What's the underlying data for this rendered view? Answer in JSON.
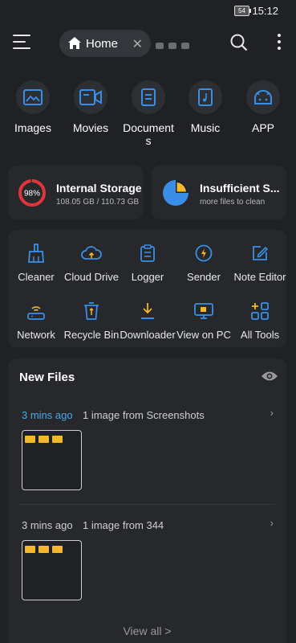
{
  "status": {
    "battery": "54",
    "time": "15:12"
  },
  "appbar": {
    "home_label": "Home",
    "close": "✕"
  },
  "categories": [
    {
      "label": "Images",
      "icon": "image-icon"
    },
    {
      "label": "Movies",
      "icon": "video-icon"
    },
    {
      "label": "Document s",
      "icon": "document-icon"
    },
    {
      "label": "Music",
      "icon": "music-icon"
    },
    {
      "label": "APP",
      "icon": "android-icon"
    }
  ],
  "storage": {
    "percent": "98%",
    "percent_value": 0.98,
    "title": "Internal Storage",
    "usage": "108.05 GB / 110.73 GB"
  },
  "clean": {
    "title": "Insufficient S...",
    "subtitle": "more files to clean"
  },
  "tools": [
    {
      "label": "Cleaner",
      "icon": "broom-icon"
    },
    {
      "label": "Cloud Drive",
      "icon": "cloud-icon"
    },
    {
      "label": "Logger",
      "icon": "clipboard-icon"
    },
    {
      "label": "Sender",
      "icon": "bolt-icon"
    },
    {
      "label": "Note Editor",
      "icon": "edit-icon"
    },
    {
      "label": "Network",
      "icon": "router-icon"
    },
    {
      "label": "Recycle Bin",
      "icon": "trash-icon"
    },
    {
      "label": "Downloader",
      "icon": "download-icon"
    },
    {
      "label": "View on PC",
      "icon": "monitor-icon"
    },
    {
      "label": "All Tools",
      "icon": "grid-plus-icon"
    }
  ],
  "new_files": {
    "title": "New Files",
    "entries": [
      {
        "time": "3 mins ago",
        "desc": "1 image from Screenshots",
        "time_color": "#4aa8e8"
      },
      {
        "time": "3 mins ago",
        "desc": "1 image from 344",
        "time_color": "#cfcfcf"
      }
    ],
    "view_all": "View all >"
  },
  "colors": {
    "accent": "#3b8ee8",
    "storage_ring": "#e0363a",
    "folder": "#f3b72c",
    "pie_blue": "#3b8ee8",
    "pie_yellow": "#f3b72c"
  }
}
